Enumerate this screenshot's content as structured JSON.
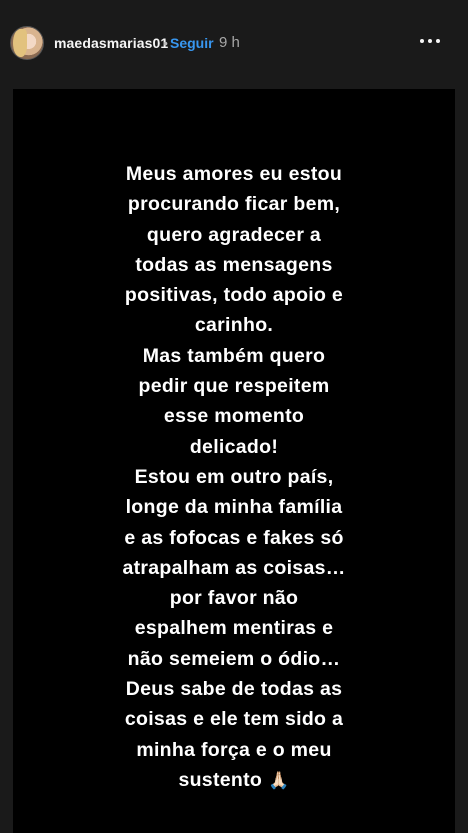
{
  "header": {
    "username": "maedasmarias01",
    "separator": "•",
    "follow_label": "Seguir",
    "time": "9 h",
    "more_icon": "more-dots-icon"
  },
  "story": {
    "lines": [
      "Meus amores eu estou",
      "procurando ficar bem,",
      "quero agradecer a",
      "todas as mensagens",
      "positivas, todo apoio e",
      "carinho.",
      "Mas também quero",
      "pedir que respeitem",
      "esse momento",
      "delicado!",
      "Estou em outro país,",
      "longe da minha família",
      "e as fofocas e fakes só",
      "atrapalham as coisas…",
      "por favor não",
      "espalhem mentiras e",
      "não semeiem o ódio…",
      "Deus sabe de todas as",
      "coisas e ele tem sido a",
      "minha força e o meu",
      "sustento"
    ],
    "emoji": "🙏🏻",
    "background_color": "#000000",
    "text_color": "#ffffff"
  },
  "colors": {
    "page_bg": "#1a1a1a",
    "follow": "#3897f0",
    "time": "#a8a8a8"
  }
}
